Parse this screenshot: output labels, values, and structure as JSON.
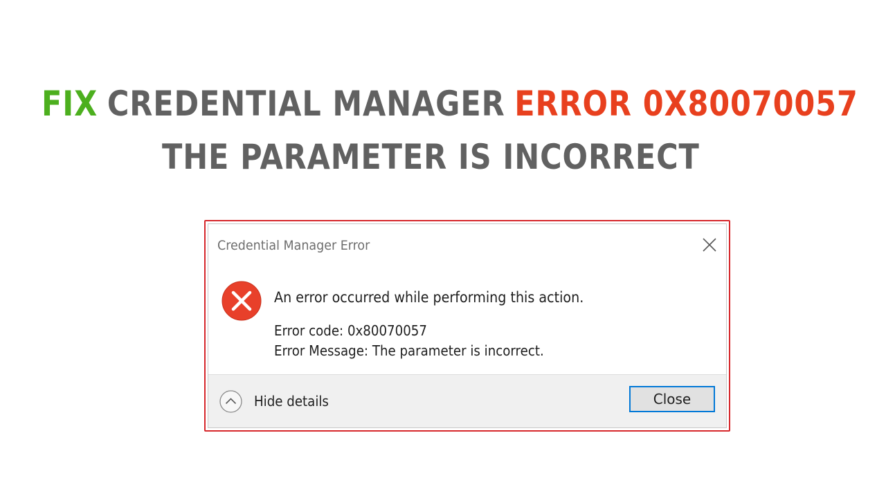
{
  "colors": {
    "green": "#4caf1e",
    "gray": "#616161",
    "red": "#e8401e",
    "dialog_border": "#d6262a",
    "button_focus": "#0078d7",
    "error_icon": "#e8402a"
  },
  "headline": {
    "line1": {
      "word_fix": "FIX",
      "word_main": "CREDENTIAL MANAGER",
      "word_error": "ERROR 0X80070057"
    },
    "line2": "THE PARAMETER IS INCORRECT"
  },
  "dialog": {
    "title": "Credential Manager Error",
    "close_icon": "close-icon",
    "error_icon": "error-icon",
    "main_message": "An error occurred while performing this action.",
    "error_code": "Error code: 0x80070057",
    "error_message": "Error Message: The parameter is incorrect.",
    "footer": {
      "hide_details_label": "Hide details",
      "hide_details_icon": "chevron-up-icon",
      "close_button_label": "Close"
    }
  }
}
